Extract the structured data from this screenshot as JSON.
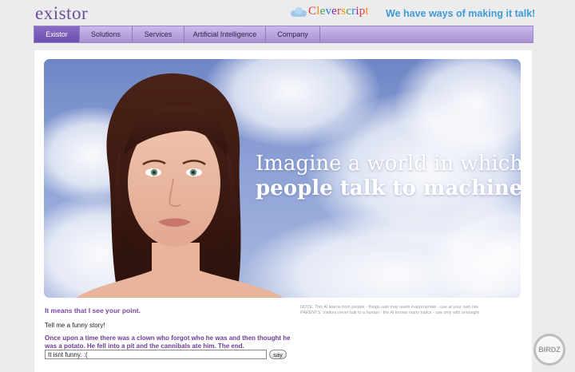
{
  "header": {
    "logo": "existor",
    "brand": [
      {
        "t": "C",
        "c": "#e53935"
      },
      {
        "t": "l",
        "c": "#fb8c00"
      },
      {
        "t": "e",
        "c": "#43a047"
      },
      {
        "t": "v",
        "c": "#1e88e5"
      },
      {
        "t": "e",
        "c": "#8e24aa"
      },
      {
        "t": "r",
        "c": "#e53935"
      },
      {
        "t": "s",
        "c": "#fb8c00"
      },
      {
        "t": "c",
        "c": "#43a047"
      },
      {
        "t": "r",
        "c": "#1e88e5"
      },
      {
        "t": "i",
        "c": "#8e24aa"
      },
      {
        "t": "p",
        "c": "#e53935"
      },
      {
        "t": "t",
        "c": "#fb8c00"
      }
    ],
    "tagline": "We have ways of making it talk!"
  },
  "nav": [
    "Existor",
    "Solutions",
    "Services",
    "Artificial Intelligence",
    "Company"
  ],
  "hero": {
    "line1": "Imagine a world in which",
    "line2": "people talk to machines"
  },
  "chat": {
    "response": "It means that I see your point.",
    "note_line1": "NOTE: This AI learns from people - things said may seem inappropriate - use at your own risk",
    "note_line2": "PARENTS: Visitors never talk to a human - the AI knows many topics - use only with oversight",
    "user_message": "Tell me a funny story!",
    "story": "Once upon a time there was a clown who forgot who he was and then thought he was a potato. He fell into a pit and the cannibals ate him. The end.",
    "input_value": "It isnt funny. :(",
    "say_label": "say"
  },
  "watermark": "BIRDZ",
  "colors": {
    "accent": "#6b4f9c",
    "tagline": "#3e9ad8",
    "nav_active": "#6b4fae",
    "response_text": "#7b47a7"
  }
}
